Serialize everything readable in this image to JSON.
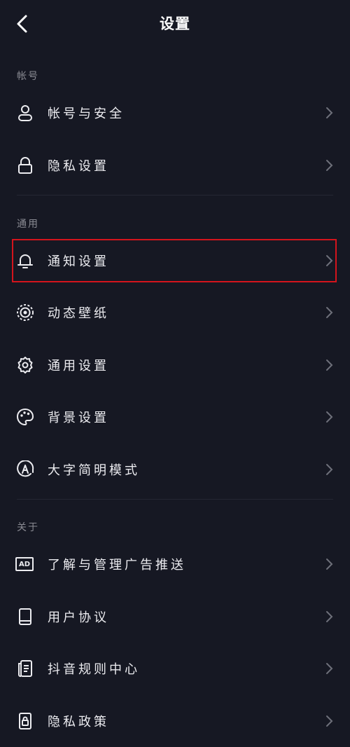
{
  "header": {
    "title": "设置",
    "back_icon": "back-arrow-icon"
  },
  "sections": [
    {
      "label": "帐号",
      "items": [
        {
          "label": "帐号与安全",
          "icon": "user-icon"
        },
        {
          "label": "隐私设置",
          "icon": "lock-icon"
        }
      ]
    },
    {
      "label": "通用",
      "items": [
        {
          "label": "通知设置",
          "icon": "bell-icon",
          "highlighted": true
        },
        {
          "label": "动态壁纸",
          "icon": "live-wallpaper-icon"
        },
        {
          "label": "通用设置",
          "icon": "gear-icon"
        },
        {
          "label": "背景设置",
          "icon": "palette-icon"
        },
        {
          "label": "大字简明模式",
          "icon": "large-text-icon"
        }
      ]
    },
    {
      "label": "关于",
      "items": [
        {
          "label": "了解与管理广告推送",
          "icon": "ad-icon",
          "icon_text": "AD"
        },
        {
          "label": "用户协议",
          "icon": "book-icon"
        },
        {
          "label": "抖音规则中心",
          "icon": "document-icon"
        },
        {
          "label": "隐私政策",
          "icon": "privacy-lock-icon"
        }
      ]
    }
  ],
  "colors": {
    "background": "#161823",
    "highlight": "#d4141c",
    "muted": "#8a8b93"
  }
}
